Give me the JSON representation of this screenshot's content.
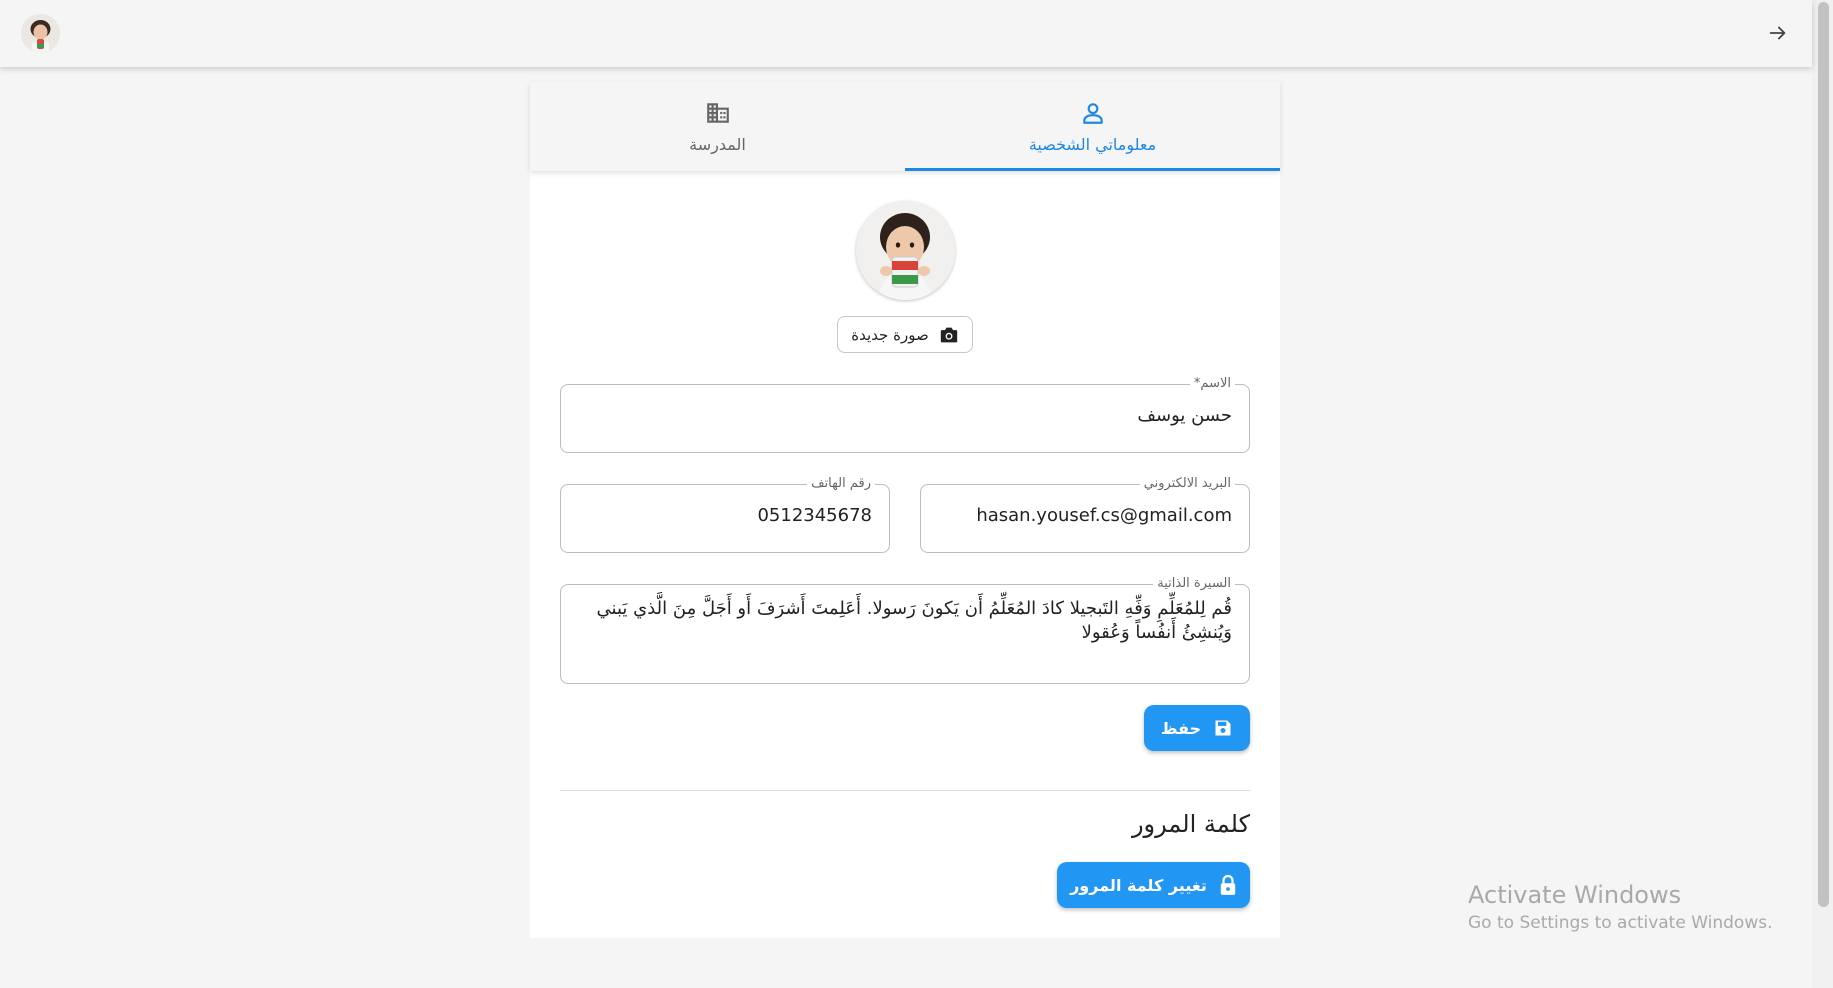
{
  "appbar": {
    "avatar_icon": "user-avatar",
    "back_icon": "arrow-right-icon"
  },
  "tabs": [
    {
      "label": "معلوماتي الشخصية",
      "icon": "person-icon",
      "active": true
    },
    {
      "label": "المدرسة",
      "icon": "building-icon",
      "active": false
    }
  ],
  "profile": {
    "new_photo_label": "صورة جديدة",
    "name_label": "الاسم*",
    "name_value": "حسن يوسف",
    "email_label": "البريد الالكتروني",
    "email_value": "hasan.yousef.cs@gmail.com",
    "phone_label": "رقم الهاتف",
    "phone_value": "0512345678",
    "bio_label": "السيرة الذاتية",
    "bio_value": "قُم لِلمُعَلِّمِ وَفِّهِ التَبجيلا كادَ المُعَلِّمُ أَن يَكونَ رَسولا. أَعَلِمتَ أَشرَفَ أَو أَجَلَّ مِنَ الَّذي يَبني وَيُنشِئُ أَنفُساً وَعُقولا",
    "save_label": "حفظ"
  },
  "password": {
    "title": "كلمة المرور",
    "change_label": "تغيير كلمة المرور"
  },
  "watermark": {
    "line1": "Activate Windows",
    "line2": "Go to Settings to activate Windows."
  },
  "colors": {
    "accent": "#2196f3",
    "tab_active": "#1e88e5",
    "background": "#f5f5f5"
  }
}
